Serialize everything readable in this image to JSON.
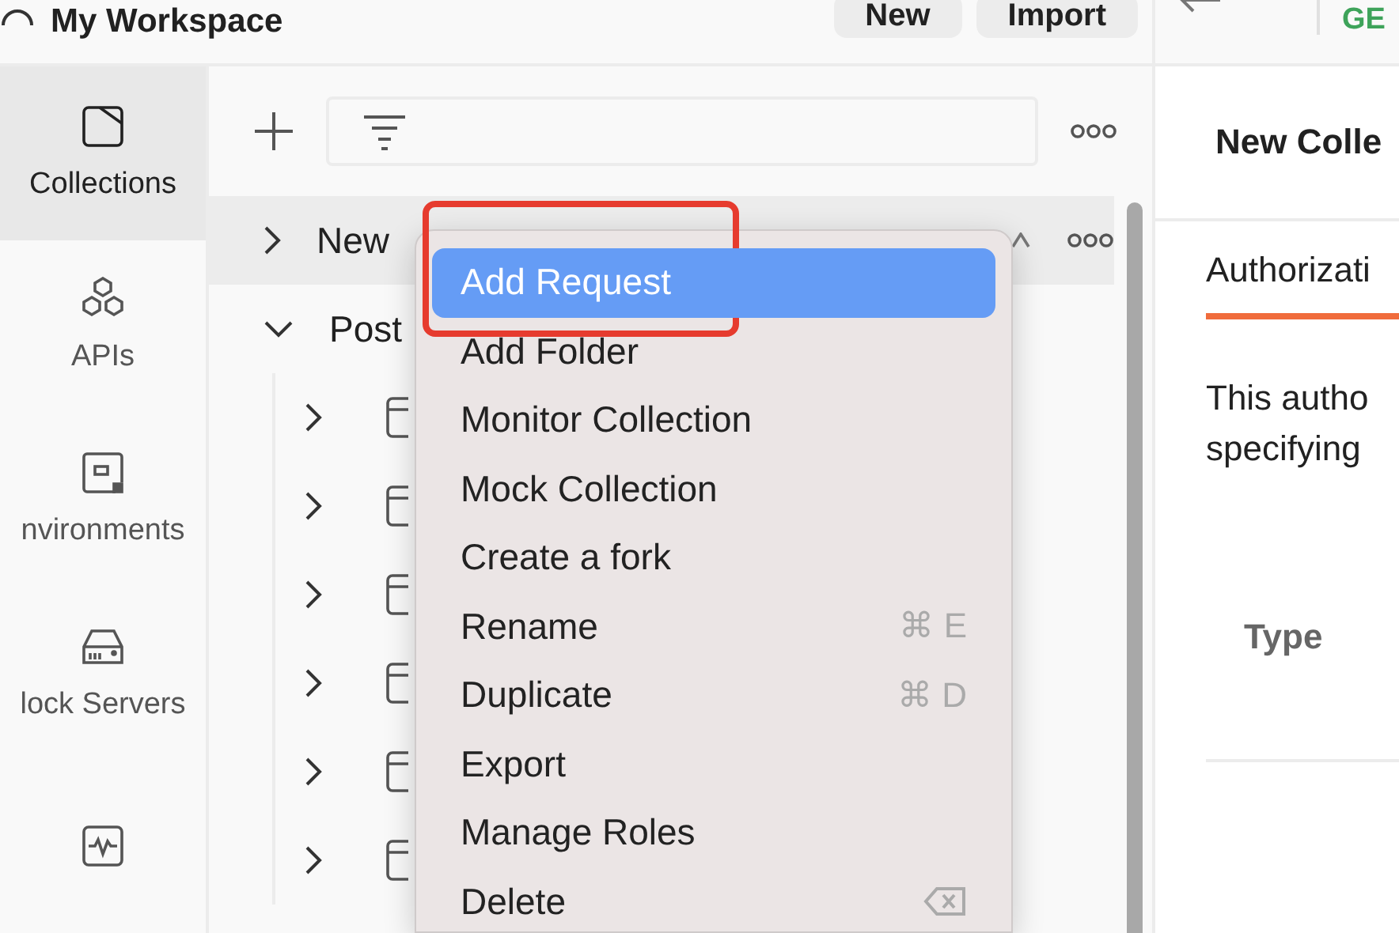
{
  "top_bar": {
    "title": "My Workspace",
    "buttons": [
      "New",
      "Import"
    ],
    "method": "GE"
  },
  "rail": [
    {
      "kind": "collections",
      "label": "Collections",
      "selected": true
    },
    {
      "kind": "apis",
      "label": "APIs",
      "selected": false
    },
    {
      "kind": "environments",
      "label": "nvironments",
      "selected": false
    },
    {
      "kind": "servers",
      "label": "lock Servers",
      "selected": false
    },
    {
      "kind": "monitors",
      "selected": false
    }
  ],
  "tree": [
    {
      "label": "New",
      "expanded": false,
      "selected": true
    },
    {
      "label": "Post",
      "expanded": true,
      "selected": false,
      "children": [
        {
          "expanded": false
        },
        {
          "expanded": false
        },
        {
          "expanded": false
        },
        {
          "expanded": false
        },
        {
          "expanded": false
        },
        {
          "expanded": false
        }
      ]
    }
  ],
  "context_menu": {
    "items": [
      {
        "label": "Add Request",
        "kind": "plain",
        "selected": true,
        "annotated": true
      },
      {
        "label": "Add Folder",
        "kind": "plain",
        "selected": false,
        "annotated": false
      },
      {
        "label": "Monitor Collection",
        "kind": "plain",
        "selected": false,
        "annotated": false
      },
      {
        "label": "Mock Collection",
        "kind": "plain",
        "selected": false,
        "annotated": false
      },
      {
        "label": "Create a fork",
        "kind": "plain",
        "selected": false,
        "annotated": false
      },
      {
        "label": "Rename",
        "kind": "shortcut",
        "shortcut": "⌘ E",
        "selected": false,
        "annotated": false
      },
      {
        "label": "Duplicate",
        "kind": "shortcut",
        "shortcut": "⌘ D",
        "selected": false,
        "annotated": false
      },
      {
        "label": "Export",
        "kind": "plain",
        "selected": false,
        "annotated": false
      },
      {
        "label": "Manage Roles",
        "kind": "plain",
        "selected": false,
        "annotated": false
      },
      {
        "label": "Delete",
        "kind": "delete",
        "selected": false,
        "annotated": false
      }
    ]
  },
  "detail": {
    "title": "New Colle",
    "tab": {
      "label": "Authorizati",
      "selected": true
    },
    "description": [
      "This autho",
      "specifying"
    ],
    "table_header": "Type"
  }
}
